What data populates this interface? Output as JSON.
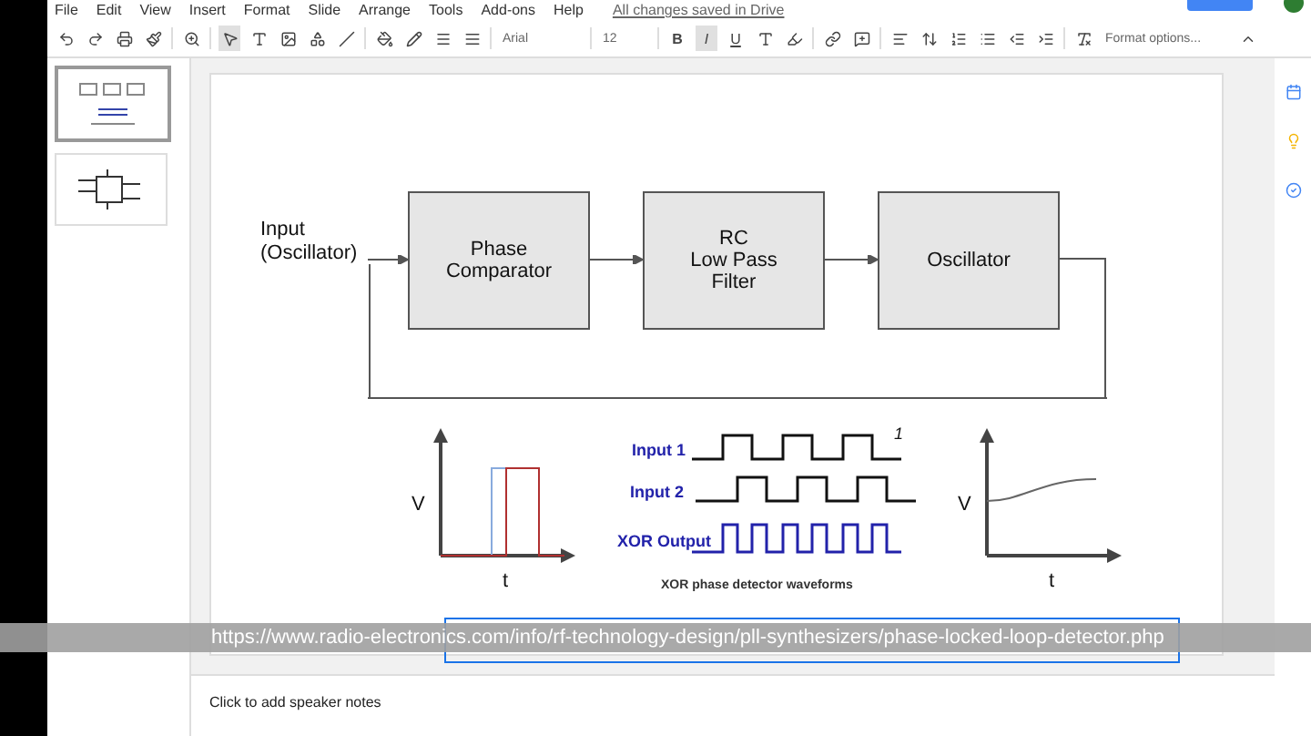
{
  "menu": [
    "File",
    "Edit",
    "View",
    "Insert",
    "Format",
    "Slide",
    "Arrange",
    "Tools",
    "Add-ons",
    "Help"
  ],
  "save_status": "All changes saved in Drive",
  "toolbar": {
    "font": "Arial",
    "size": "12",
    "format_options": "Format options...",
    "styles": [
      {
        "label": "B",
        "kind": "bold",
        "selected": false
      },
      {
        "label": "I",
        "kind": "italic",
        "selected": true
      },
      {
        "label": "U",
        "kind": "underline",
        "selected": false
      }
    ]
  },
  "thumbnails": [
    {
      "kind": "loop",
      "selected": true
    },
    {
      "kind": "circuit",
      "selected": false
    }
  ],
  "slide": {
    "input_label": "Input\n(Oscillator)",
    "blocks": [
      "Phase\nComparator",
      "RC\nLow Pass\nFilter",
      "Oscillator"
    ],
    "left_graph": {
      "ylabel": "V",
      "xlabel": "t"
    },
    "waveforms": {
      "labels": [
        "Input 1",
        "Input 2",
        "XOR Output"
      ],
      "mark": "1",
      "caption": "XOR phase detector waveforms"
    },
    "right_graph": {
      "ylabel": "V",
      "xlabel": "t"
    }
  },
  "notes_placeholder": "Click to add speaker notes",
  "url_caption": "https://www.radio-electronics.com/info/rf-technology-design/pll-synthesizers/phase-locked-loop-detector.php"
}
